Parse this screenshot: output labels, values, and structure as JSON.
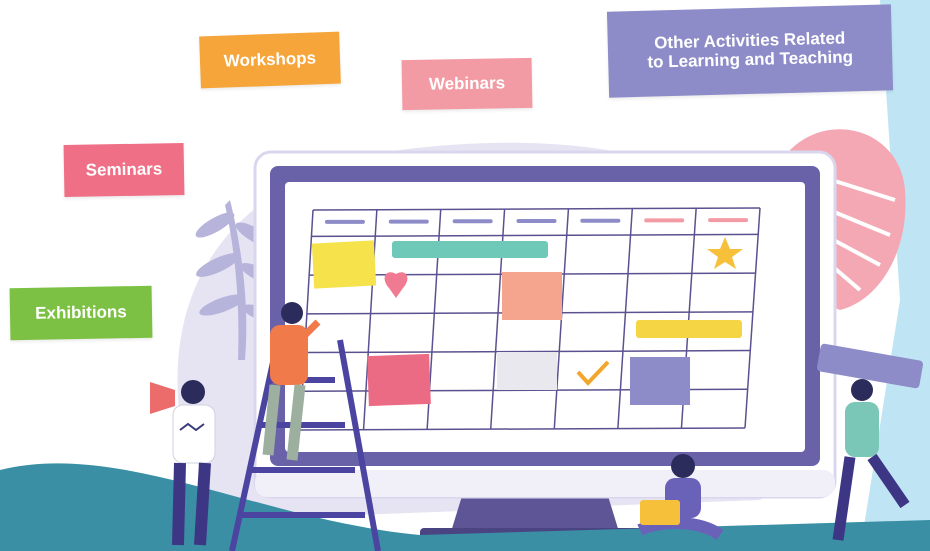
{
  "tags": {
    "workshops": "Workshops",
    "webinars": "Webinars",
    "other_line1": "Other Activities Related",
    "other_line2": "to Learning and Teaching",
    "seminars": "Seminars",
    "exhibitions": "Exhibitions"
  },
  "colors": {
    "workshops": "#f5a53a",
    "webinars": "#f29ba5",
    "other": "#8d8cc8",
    "seminars": "#ef6f87",
    "exhibitions": "#7cc144",
    "monitor_frame": "#6a62a8",
    "ground": "#3a8fa5"
  },
  "calendar": {
    "columns": 7,
    "rows": 5,
    "icons": [
      "heart-icon",
      "star-icon",
      "checkmark-icon"
    ]
  }
}
